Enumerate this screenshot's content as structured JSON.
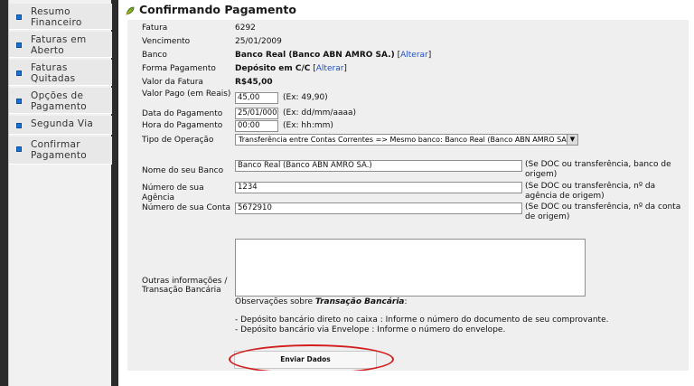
{
  "sidebar": {
    "items": [
      {
        "label": "Resumo Financeiro"
      },
      {
        "label": "Faturas em Aberto"
      },
      {
        "label": "Faturas Quitadas"
      },
      {
        "label": "Opções de Pagamento"
      },
      {
        "label": "Segunda Via"
      },
      {
        "label": "Confirmar Pagamento"
      }
    ]
  },
  "header": {
    "title": "Confirmando Pagamento"
  },
  "form": {
    "fatura_label": "Fatura",
    "fatura_value": "6292",
    "vencimento_label": "Vencimento",
    "vencimento_value": "25/01/2009",
    "banco_label": "Banco",
    "banco_value": "Banco Real (Banco ABN AMRO SA.)",
    "banco_link_open": "[",
    "banco_link": "Alterar",
    "banco_link_close": "]",
    "forma_label": "Forma Pagamento",
    "forma_value": "Depósito em C/C",
    "forma_link_open": "[",
    "forma_link": "Alterar",
    "forma_link_close": "]",
    "valor_fatura_label": "Valor da Fatura",
    "valor_fatura_value": "R$45,00",
    "valor_pago_label": "Valor Pago (em Reais)",
    "valor_pago_value": "45,00",
    "valor_pago_hint": "(Ex: 49,90)",
    "data_label": "Data do Pagamento",
    "data_value": "25/01/000",
    "data_hint": "(Ex: dd/mm/aaaa)",
    "hora_label": "Hora do Pagamento",
    "hora_value": "00:00",
    "hora_hint": "(Ex: hh:mm)",
    "tipo_label": "Tipo de Operação",
    "tipo_value": "Transferência entre Contas Correntes => Mesmo banco: Banco Real (Banco ABN AMRO SA.)",
    "nome_banco_label": "Nome do seu Banco",
    "nome_banco_value": "Banco Real (Banco ABN AMRO SA.)",
    "nome_banco_hint": "(Se DOC ou transferência, banco de origem)",
    "agencia_label": "Número de sua Agência",
    "agencia_value": "1234",
    "agencia_hint": "(Se DOC ou transferência, nº da agência de origem)",
    "conta_label": "Número de sua Conta",
    "conta_value": "5672910",
    "conta_hint": "(Se DOC ou transferência, nº da conta de origem)",
    "outras_label": "Outras informações / Transação Bancária",
    "obs_prefix": "Observações sobre",
    "obs_emph": "Transação Bancária",
    "obs_suffix": ":",
    "obs_line1": "- Depósito bancário direto no caixa : Informe o número do documento de seu comprovante.",
    "obs_line2": "- Depósito bancário via Envelope : Informe o número do envelope.",
    "submit_label": "Enviar Dados"
  },
  "colors": {
    "accent_link": "#1f4fbf",
    "highlight": "#d21d1d",
    "menu_bullet": "#1a6fcf"
  }
}
